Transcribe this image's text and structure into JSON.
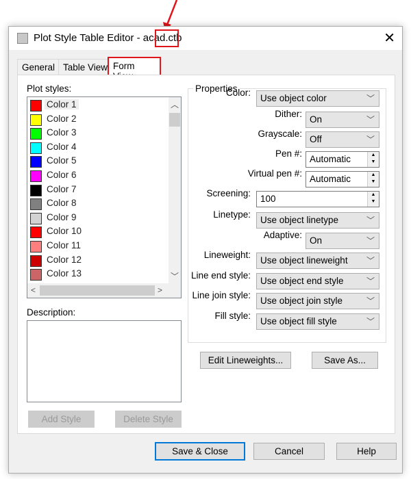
{
  "window": {
    "title": "Plot Style Table Editor - acad.ctb",
    "close_label": "✕"
  },
  "tabs": [
    {
      "label": "General"
    },
    {
      "label": "Table View"
    },
    {
      "label": "Form View",
      "active": true
    }
  ],
  "plot_styles": {
    "label": "Plot styles:",
    "items": [
      {
        "label": "Color 1",
        "color": "#ff0000"
      },
      {
        "label": "Color 2",
        "color": "#ffff00"
      },
      {
        "label": "Color 3",
        "color": "#00ff00"
      },
      {
        "label": "Color 4",
        "color": "#00ffff"
      },
      {
        "label": "Color 5",
        "color": "#0000ff"
      },
      {
        "label": "Color 6",
        "color": "#ff00ff"
      },
      {
        "label": "Color 7",
        "color": "#000000"
      },
      {
        "label": "Color 8",
        "color": "#808080"
      },
      {
        "label": "Color 9",
        "color": "#d3d3d3"
      },
      {
        "label": "Color 10",
        "color": "#ff0000"
      },
      {
        "label": "Color 11",
        "color": "#ff7f7f"
      },
      {
        "label": "Color 12",
        "color": "#cc0000"
      },
      {
        "label": "Color 13",
        "color": "#cc6666"
      }
    ],
    "selected": "Color 1"
  },
  "description": {
    "label": "Description:",
    "value": ""
  },
  "left_buttons": {
    "add_style": "Add Style",
    "delete_style": "Delete Style"
  },
  "properties": {
    "label": "Properties",
    "color": {
      "label": "Color:",
      "value": "Use object color"
    },
    "dither": {
      "label": "Dither:",
      "value": "On"
    },
    "grayscale": {
      "label": "Grayscale:",
      "value": "Off"
    },
    "pen": {
      "label": "Pen #:",
      "value": "Automatic"
    },
    "virtual_pen": {
      "label": "Virtual pen #:",
      "value": "Automatic"
    },
    "screening": {
      "label": "Screening:",
      "value": "100"
    },
    "linetype": {
      "label": "Linetype:",
      "value": "Use object linetype"
    },
    "adaptive": {
      "label": "Adaptive:",
      "value": "On"
    },
    "lineweight": {
      "label": "Lineweight:",
      "value": "Use object lineweight"
    },
    "line_end": {
      "label": "Line end style:",
      "value": "Use object end style"
    },
    "line_join": {
      "label": "Line join style:",
      "value": "Use object join style"
    },
    "fill": {
      "label": "Fill style:",
      "value": "Use object fill style"
    }
  },
  "buttons": {
    "edit_lineweights": "Edit Lineweights...",
    "save_as": "Save As...",
    "save_close": "Save & Close",
    "cancel": "Cancel",
    "help": "Help"
  },
  "annotation_color": "#e0151b"
}
